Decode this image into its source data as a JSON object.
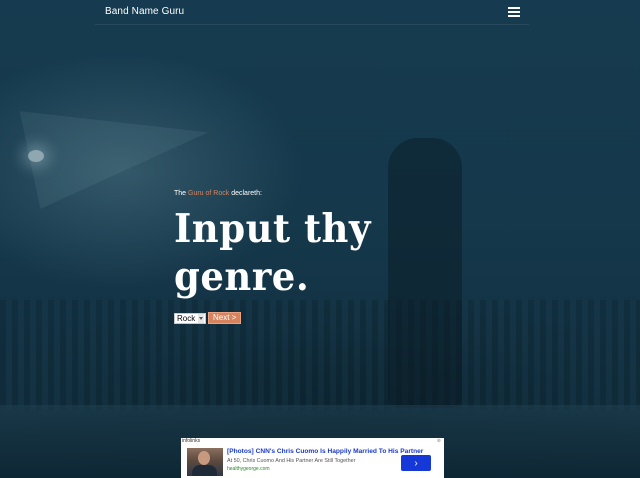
{
  "navbar": {
    "brand": "Band Name Guru"
  },
  "hero": {
    "declare_prefix": "The ",
    "declare_link": "Guru of Rock",
    "declare_suffix": " declareth:",
    "headline": "Input thy genre.",
    "genre_value": "Rock",
    "next_label": "Next >"
  },
  "ad": {
    "source": "infolinks",
    "close": "⊗",
    "title": "[Photos] CNN's Chris Cuomo Is Happily Married To His Partner",
    "description": "At 50, Chris Cuomo And His Partner Are Still Together",
    "domain": "healthygeorge.com",
    "go_glyph": "›"
  },
  "colors": {
    "background": "#143446",
    "accent": "#d7845e",
    "ad_button": "#1638d8",
    "ad_title": "#1a3ac7"
  }
}
